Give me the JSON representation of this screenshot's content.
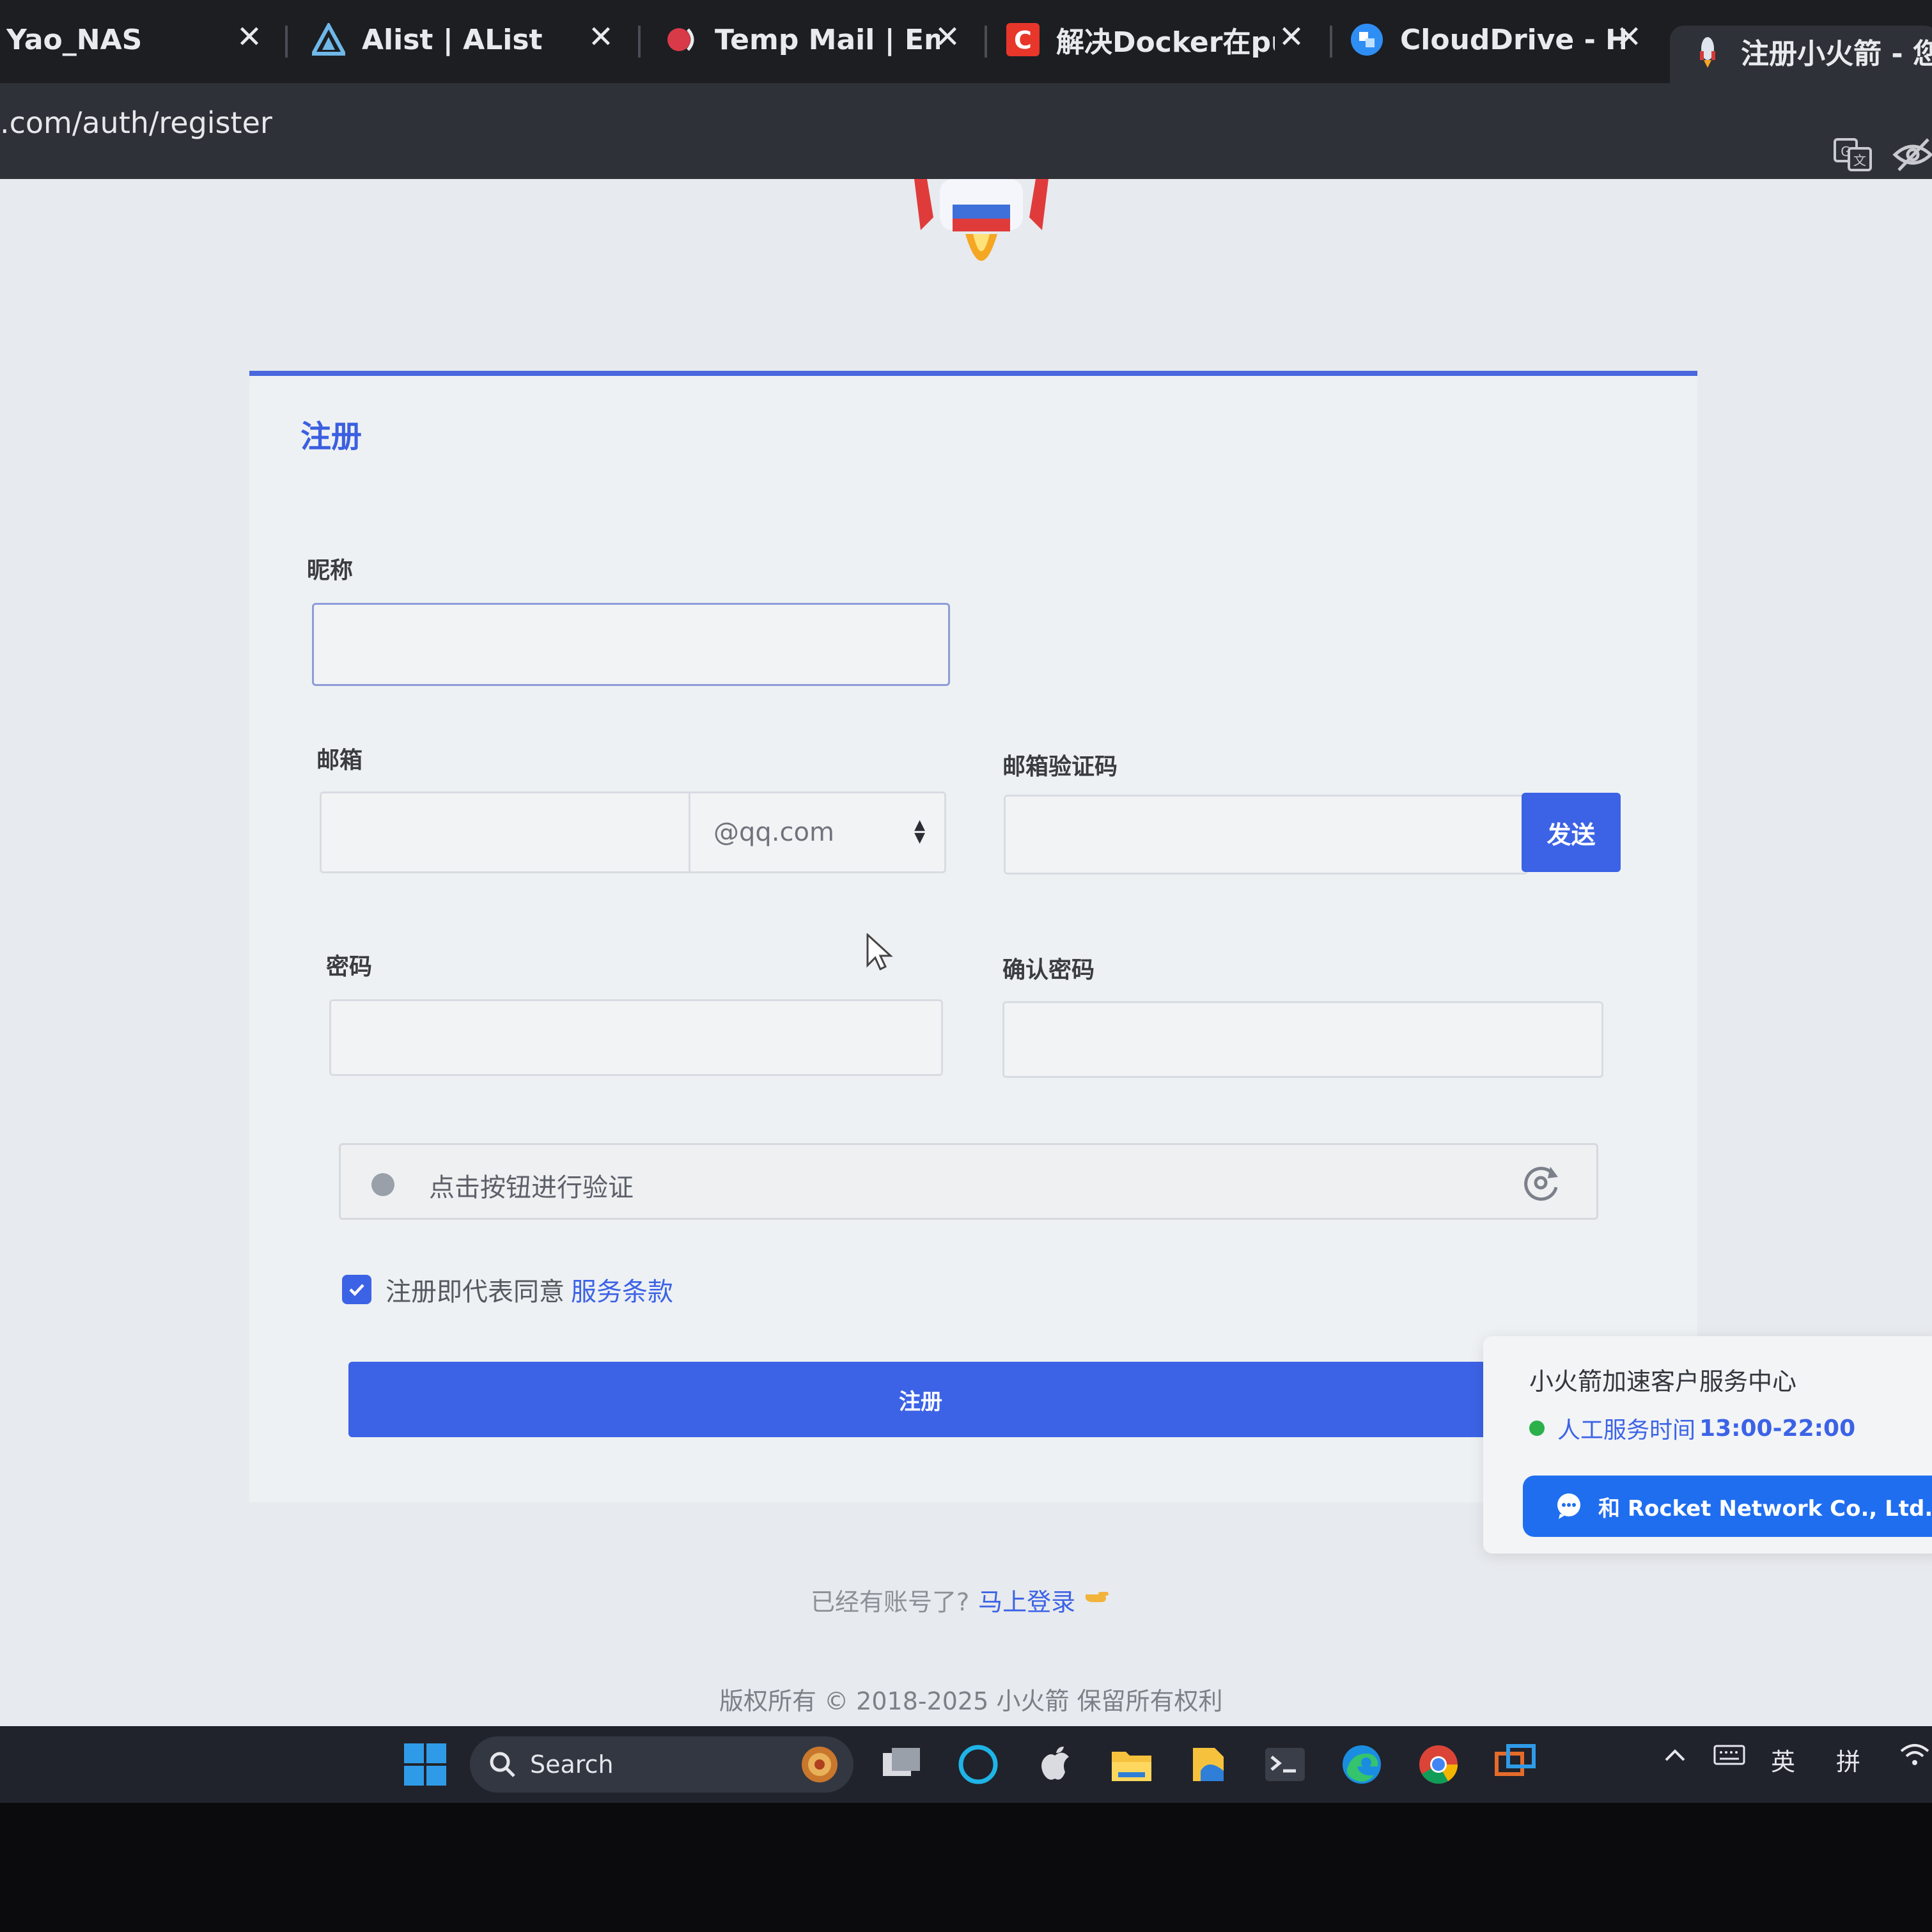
{
  "browser": {
    "tabs": [
      {
        "label": "Yao_NAS"
      },
      {
        "label": "Alist | AList"
      },
      {
        "label": "Temp Mail | Email"
      },
      {
        "label": "解决Docker在pull"
      },
      {
        "label": "CloudDrive - Hom"
      },
      {
        "label": "注册小火箭 - 您身"
      }
    ],
    "tab_close": "✕",
    "url": ".com/auth/register"
  },
  "form": {
    "title": "注册",
    "nickname_label": "昵称",
    "email_label": "邮箱",
    "email_suffix": "@qq.com",
    "email_code_label": "邮箱验证码",
    "send_label": "发送",
    "password_label": "密码",
    "confirm_password_label": "确认密码",
    "captcha_text": "点击按钮进行验证",
    "agree_text": "注册即代表同意",
    "terms_link": "服务条款",
    "agree_checked": true,
    "submit_label": "注册"
  },
  "support": {
    "title": "小火箭加速客户服务中心",
    "hours_label": "人工服务时间",
    "hours_value": "13:00-22:00",
    "chat_label": "和 Rocket Network Co., Ltd. 聊天"
  },
  "footer": {
    "have_account": "已经有账号了?",
    "login_link": "马上登录",
    "copyright": "版权所有 © 2018-2025 小火箭 保留所有权利"
  },
  "taskbar": {
    "search_label": "Search",
    "ime_lang": "英",
    "ime_mode": "拼"
  },
  "colors": {
    "accent": "#3c63e6",
    "status_online": "#2bb04a",
    "chat_button": "#1f6ef0"
  }
}
